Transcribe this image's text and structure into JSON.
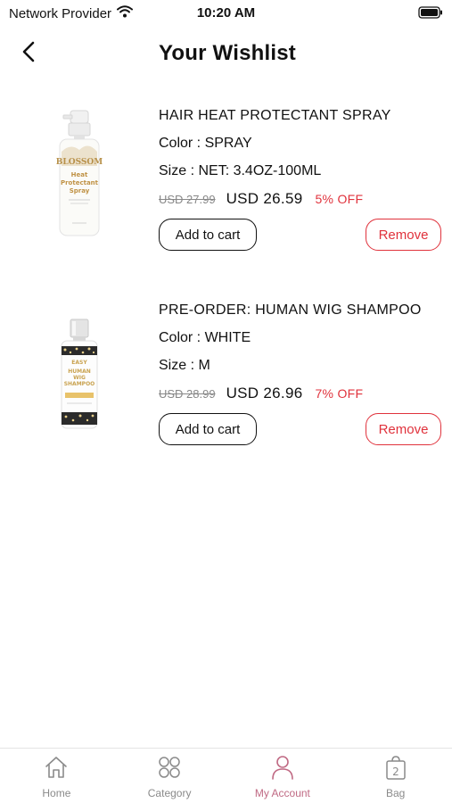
{
  "status_bar": {
    "carrier": "Network Provider",
    "time": "10:20 AM"
  },
  "header": {
    "title": "Your Wishlist"
  },
  "wishlist": [
    {
      "name": "HAIR HEAT PROTECTANT SPRAY",
      "color": "Color : SPRAY",
      "size": "Size : NET: 3.4OZ-100ML",
      "old_price": "USD 27.99",
      "price": "USD 26.59",
      "discount": "5% OFF",
      "add_label": "Add to cart",
      "remove_label": "Remove",
      "image_text": [
        "BLOSSOM",
        "Heat",
        "Protectant",
        "Spray"
      ]
    },
    {
      "name": "PRE-ORDER: HUMAN WIG SHAMPOO",
      "color": "Color : WHITE",
      "size": "Size : M",
      "old_price": "USD 28.99",
      "price": "USD 26.96",
      "discount": "7% OFF",
      "add_label": "Add to cart",
      "remove_label": "Remove",
      "image_text": [
        "EASY",
        "HUMAN",
        "WIG",
        "SHAMPOO"
      ]
    }
  ],
  "bottom_nav": [
    {
      "label": "Home",
      "icon": "home-icon",
      "active": false
    },
    {
      "label": "Category",
      "icon": "category-icon",
      "active": false
    },
    {
      "label": "My Account",
      "icon": "account-icon",
      "active": true
    },
    {
      "label": "Bag",
      "icon": "bag-icon",
      "active": false,
      "badge": "2"
    }
  ],
  "colors": {
    "accent_red": "#e0323c",
    "active_nav": "#c06a84",
    "inactive_nav": "#8a8a8a"
  }
}
